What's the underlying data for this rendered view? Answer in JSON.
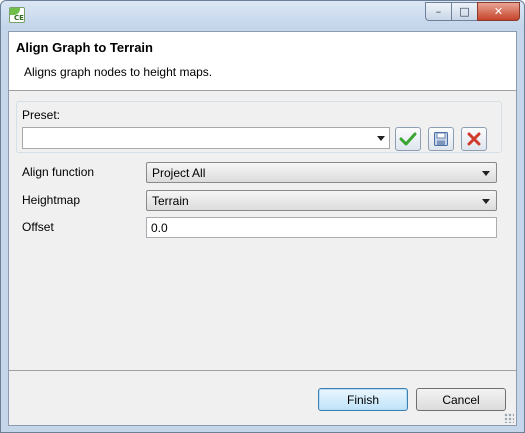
{
  "window": {
    "app_icon_text": "CE",
    "controls": {
      "minimize": "–",
      "maximize": "□",
      "close": "✕"
    }
  },
  "header": {
    "title": "Align Graph to Terrain",
    "description": "Aligns graph nodes to height maps."
  },
  "preset": {
    "label": "Preset:",
    "value": ""
  },
  "fields": {
    "align_function": {
      "label": "Align function",
      "value": "Project All"
    },
    "heightmap": {
      "label": "Heightmap",
      "value": "Terrain"
    },
    "offset": {
      "label": "Offset",
      "value": "0.0"
    }
  },
  "buttons": {
    "finish": "Finish",
    "cancel": "Cancel"
  },
  "colors": {
    "accept_icon": "#3aa532",
    "delete_icon": "#d03a2a",
    "save_icon": "#4a6fa5"
  }
}
